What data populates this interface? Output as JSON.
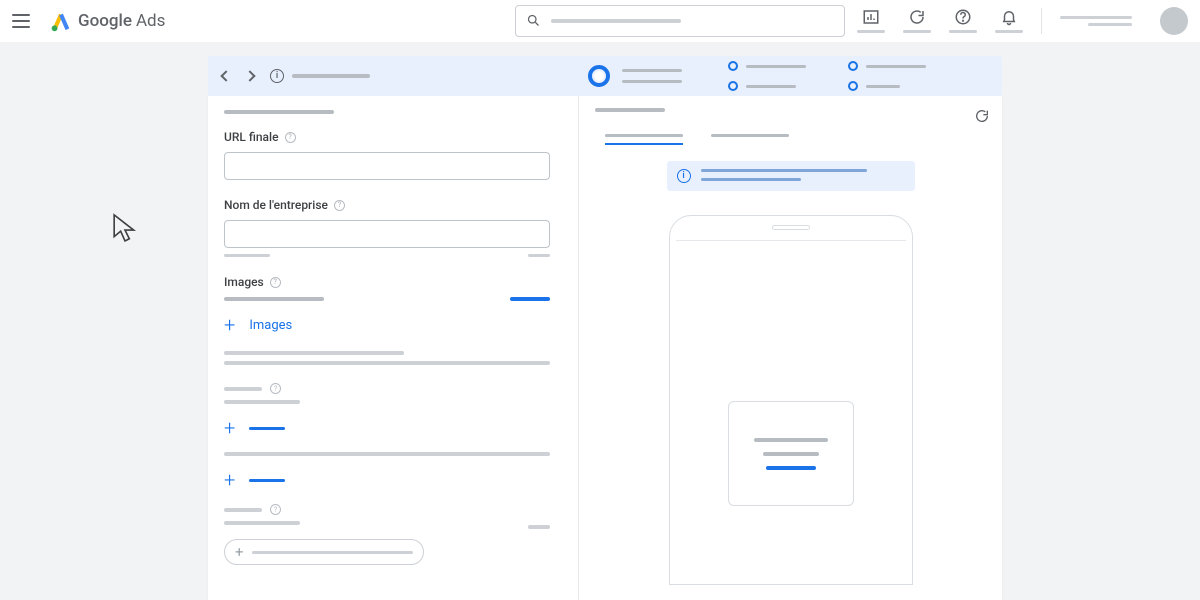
{
  "header": {
    "product_name_1": "Google",
    "product_name_2": "Ads",
    "search_placeholder": ""
  },
  "form": {
    "section_placeholder": "",
    "url_label": "URL finale",
    "business_label": "Nom de l'entreprise",
    "images_label": "Images",
    "add_images_label": "Images"
  },
  "preview": {
    "tab1": "",
    "tab2": ""
  }
}
